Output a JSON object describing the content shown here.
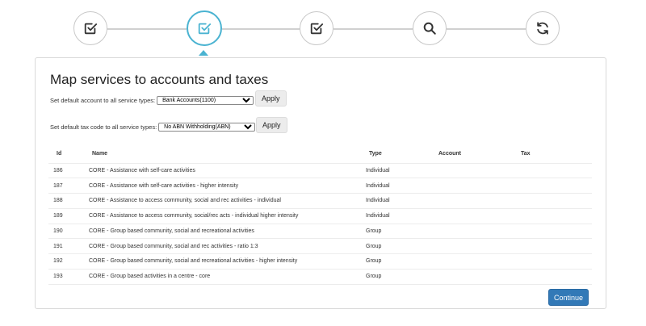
{
  "stepper": {
    "steps": [
      {
        "icon": "checkbox-check-icon",
        "active": false
      },
      {
        "icon": "checkbox-check-icon",
        "active": true
      },
      {
        "icon": "checkbox-check-icon",
        "active": false
      },
      {
        "icon": "search-icon",
        "active": false
      },
      {
        "icon": "refresh-icon",
        "active": false
      }
    ],
    "accent_color": "#4ab3d1"
  },
  "page": {
    "title": "Map services to accounts and taxes",
    "default_account": {
      "label": "Set default account to all service types:",
      "selected": "Bank Accounts(1100)",
      "apply_label": "Apply"
    },
    "default_tax": {
      "label": "Set default tax code to all service types:",
      "selected": "No ABN Withholding(ABN)",
      "apply_label": "Apply"
    },
    "table": {
      "headers": {
        "id": "Id",
        "name": "Name",
        "type": "Type",
        "account": "Account",
        "tax": "Tax"
      },
      "rows": [
        {
          "id": "186",
          "name": "CORE - Assistance with self-care activities",
          "type": "Individual"
        },
        {
          "id": "187",
          "name": "CORE - Assistance with self-care activities - higher intensity",
          "type": "Individual"
        },
        {
          "id": "188",
          "name": "CORE - Assistance to access community, social and rec activities - individual",
          "type": "Individual"
        },
        {
          "id": "189",
          "name": "CORE - Assistance to access community, social/rec acts - individual higher intensity",
          "type": "Individual"
        },
        {
          "id": "190",
          "name": "CORE - Group based community, social and recreational activities",
          "type": "Group"
        },
        {
          "id": "191",
          "name": "CORE - Group based community, social and rec activities - ratio 1:3",
          "type": "Group"
        },
        {
          "id": "192",
          "name": "CORE - Group based community, social and recreational activities - higher intensity",
          "type": "Group"
        },
        {
          "id": "193",
          "name": "CORE - Group based activities in a centre - core",
          "type": "Group"
        }
      ]
    },
    "continue_label": "Continue",
    "continue_color": "#3279b7"
  }
}
